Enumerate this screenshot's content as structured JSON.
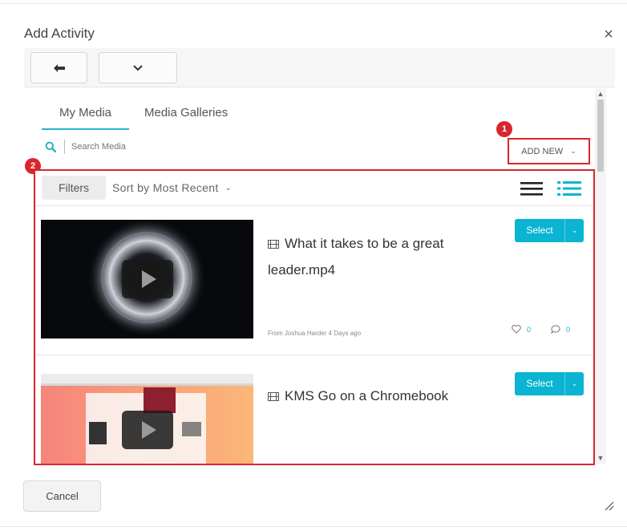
{
  "dialog": {
    "title": "Add Activity",
    "close_glyph": "×",
    "cancel_label": "Cancel"
  },
  "toolbar": {
    "back_icon": "back-arrow-icon",
    "menu_icon": "chevron-down-icon"
  },
  "tabs": [
    {
      "label": "My Media",
      "active": true
    },
    {
      "label": "Media Galleries",
      "active": false
    }
  ],
  "search": {
    "placeholder": "Search Media",
    "icon": "search-icon"
  },
  "add_new": {
    "label": "ADD NEW",
    "chevron": "⌄"
  },
  "callouts": [
    "1",
    "2"
  ],
  "list_controls": {
    "filters_label": "Filters",
    "sort_label": "Sort by Most Recent",
    "sort_chevron": "⌄",
    "view_modes": [
      "detailed-view-icon",
      "list-view-icon"
    ]
  },
  "entries": [
    {
      "title": "What it takes to be a great leader.mp4",
      "type_icon": "video-film-icon",
      "select_label": "Select",
      "select_caret": "⌄",
      "meta": "From Joshua Harder 4 Days ago",
      "likes": "0",
      "comments": "0"
    },
    {
      "title": "KMS Go on a Chromebook",
      "type_icon": "video-film-icon",
      "select_label": "Select",
      "select_caret": "⌄"
    }
  ],
  "colors": {
    "accent": "#0ab4d2",
    "tab_underline": "#2ab0c9",
    "callout_red": "#d9262e"
  },
  "scrollbar": {
    "up": "▲",
    "down": "▼"
  }
}
